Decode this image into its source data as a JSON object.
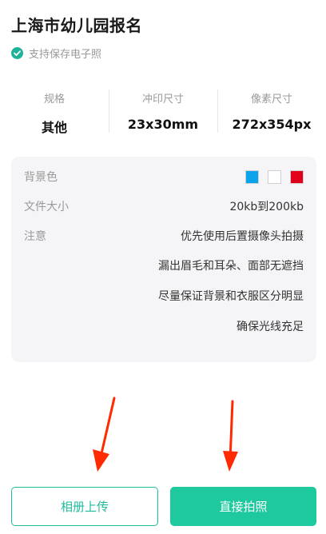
{
  "header": {
    "title": "上海市幼儿园报名",
    "support_text": "支持保存电子照",
    "check_icon": "check-circle-icon",
    "accent_color": "#1db399"
  },
  "specs": [
    {
      "label": "规格",
      "value": "其他"
    },
    {
      "label": "冲印尺寸",
      "value": "23x30mm"
    },
    {
      "label": "像素尺寸",
      "value": "272x354px"
    }
  ],
  "details": {
    "background_label": "背景色",
    "background_colors": [
      "#0aa3ec",
      "#ffffff",
      "#e0001b"
    ],
    "filesize_label": "文件大小",
    "filesize_value": "20kb到200kb",
    "notes_label": "注意",
    "notes": [
      "优先使用后置摄像头拍摄",
      "漏出眉毛和耳朵、面部无遮挡",
      "尽量保证背景和衣服区分明显",
      "确保光线充足"
    ]
  },
  "buttons": {
    "album_label": "相册上传",
    "camera_label": "直接拍照",
    "album_color": "#1fbc9c",
    "camera_color": "#1ec99e"
  },
  "annotations": {
    "arrow_color": "#ff2a00",
    "arrow_icon": "red-arrow-down-icon"
  }
}
